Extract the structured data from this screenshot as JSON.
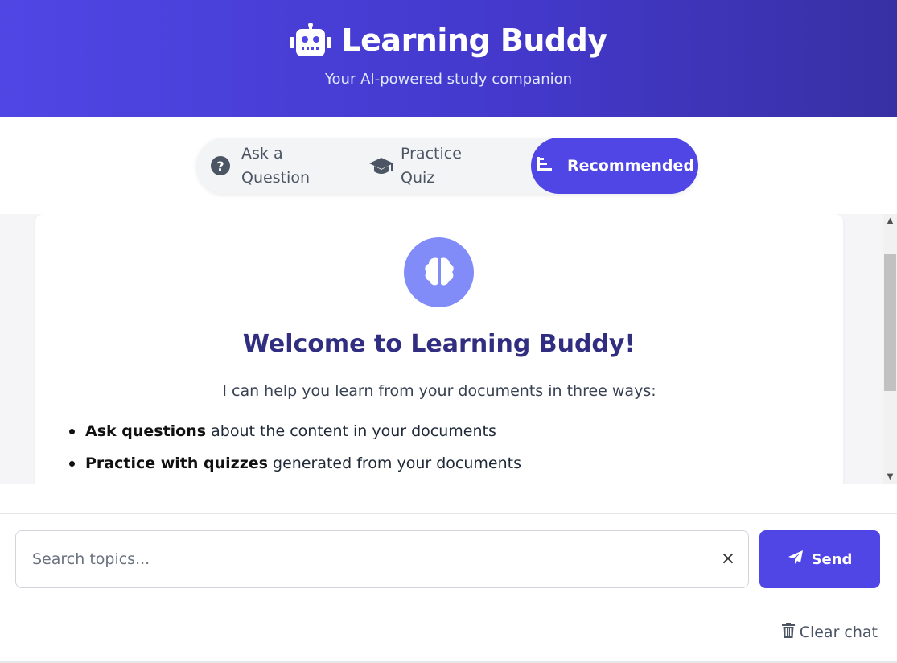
{
  "header": {
    "title": "Learning Buddy",
    "subtitle": "Your AI-powered study companion",
    "icon": "robot-icon"
  },
  "tabs": [
    {
      "label": "Ask a Question",
      "line1": "Ask a",
      "line2": "Question",
      "icon": "question-circle-icon",
      "active": false
    },
    {
      "label": "Practice Quiz",
      "line1": "Practice",
      "line2": "Quiz",
      "icon": "graduation-cap-icon",
      "active": false
    },
    {
      "label": "Recommended",
      "icon": "list-icon",
      "active": true
    }
  ],
  "welcome": {
    "icon": "brain-icon",
    "title": "Welcome to Learning Buddy!",
    "intro": "I can help you learn from your documents in three ways:",
    "features": [
      {
        "bold": "Ask questions",
        "text": " about the content in your documents"
      },
      {
        "bold": "Practice with quizzes",
        "text": " generated from your documents"
      }
    ]
  },
  "search": {
    "placeholder": "Search topics...",
    "value": "",
    "clear_label": "×"
  },
  "send": {
    "label": "Send",
    "icon": "paper-plane-icon"
  },
  "footer": {
    "clear_label": "Clear chat",
    "icon": "trash-icon"
  },
  "colors": {
    "primary": "#4f46e5",
    "heading": "#312e81",
    "brain_circle": "#818cf8"
  }
}
